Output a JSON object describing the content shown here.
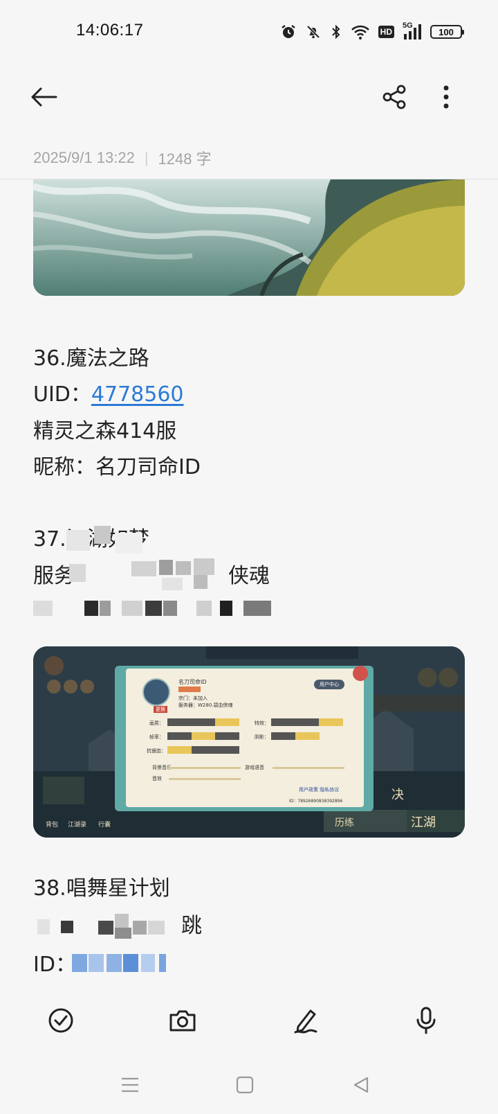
{
  "status_bar": {
    "time": "14:06:17",
    "network": "5G",
    "hd_badge": "HD",
    "battery": "100"
  },
  "toolbar": {
    "back_icon": "back-arrow-icon",
    "share_icon": "share-icon",
    "more_icon": "more-vertical-icon"
  },
  "note_meta": {
    "datetime": "2025/9/1 13:22",
    "separator": "|",
    "word_count": "1248 字"
  },
  "entries": [
    {
      "title": "36.魔法之路",
      "uid_label": "UID：",
      "uid_value": "4778560",
      "server": "精灵之森414服",
      "nickname": "昵称：名刀司命ID"
    },
    {
      "title_visible": "37.江湖如梦",
      "line2_prefix": "服务",
      "line2_suffix": "侠魂"
    },
    {
      "title": "38.唱舞星计划",
      "line2_suffix": "跳",
      "line3_prefix": "ID："
    }
  ],
  "game_screenshot": {
    "name": "名刀司命ID",
    "sect_label": "宗门：",
    "sect_value": "未加入",
    "server_label": "服务器：",
    "server_value": "W280.碧血侠魂",
    "change_btn": "更换",
    "user_center": "用户中心",
    "settings": [
      {
        "label": "画质：",
        "options": [
          "低",
          "中",
          "高"
        ],
        "selected": 2
      },
      {
        "label": "特效：",
        "options": [
          "低",
          "中",
          "高"
        ],
        "selected": 2
      },
      {
        "label": "帧率：",
        "options": [
          "低",
          "中",
          "高"
        ],
        "selected": 1
      },
      {
        "label": "阴影：",
        "options": [
          "关",
          "开"
        ],
        "selected": 1
      },
      {
        "label": "抗锯齿：",
        "options": [
          "低",
          "中"
        ],
        "selected": 0
      }
    ],
    "bgm_label": "背景音乐",
    "voice_label": "游戏语音",
    "sfx_label": "音效",
    "user_policy": "用户政策",
    "privacy": "隐私协议",
    "id_text": "ID：7892689083839​2896",
    "right_labels": [
      "决",
      "历练",
      "江湖"
    ],
    "left_labels": [
      "背包",
      "江湖录",
      "行囊"
    ]
  },
  "bottom_toolbar": {
    "icons": [
      "checklist-icon",
      "camera-icon",
      "handwriting-icon",
      "microphone-icon"
    ]
  },
  "nav_bar": {
    "icons": [
      "menu-icon",
      "home-icon",
      "back-icon"
    ]
  }
}
